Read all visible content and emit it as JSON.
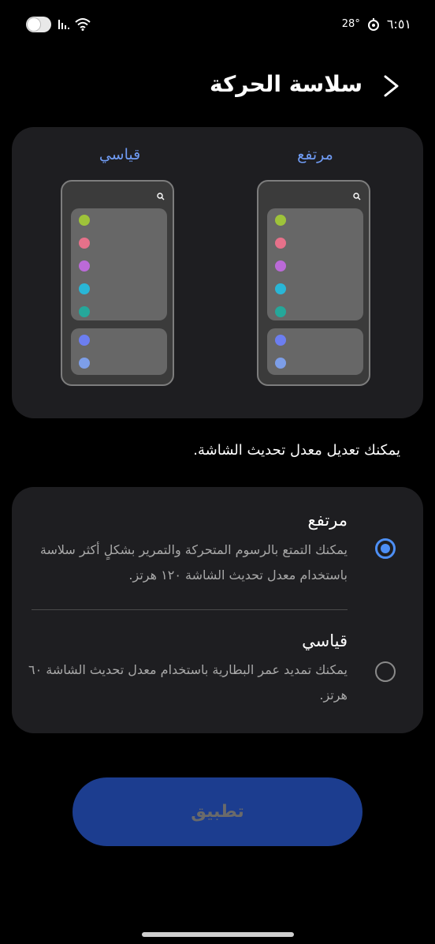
{
  "status_bar": {
    "time": "٦:٥١",
    "temperature": "28°"
  },
  "header": {
    "title": "سلاسة الحركة"
  },
  "preview": {
    "high_label": "مرتفع",
    "standard_label": "قياسي",
    "dot_colors_top": [
      "#9ec33a",
      "#e6718a",
      "#bb6ad8",
      "#29b6d6",
      "#25a79a"
    ],
    "dot_colors_bottom": [
      "#6c7ef0",
      "#7d9ee8"
    ]
  },
  "description": "يمكنك تعديل معدل تحديث الشاشة.",
  "options": [
    {
      "title": "مرتفع",
      "desc": "يمكنك التمتع بالرسوم المتحركة والتمرير بشكلٍ أكثر سلاسة باستخدام معدل تحديث الشاشة ١٢٠ هرتز.",
      "selected": true
    },
    {
      "title": "قياسي",
      "desc": "يمكنك تمديد عمر البطارية باستخدام معدل تحديث الشاشة ٦٠ هرتز.",
      "selected": false
    }
  ],
  "apply_button": {
    "label": "تطبيق"
  },
  "colors": {
    "accent": "#4d8ff5",
    "card": "#1e1e21",
    "button": "#1c3d8f"
  }
}
